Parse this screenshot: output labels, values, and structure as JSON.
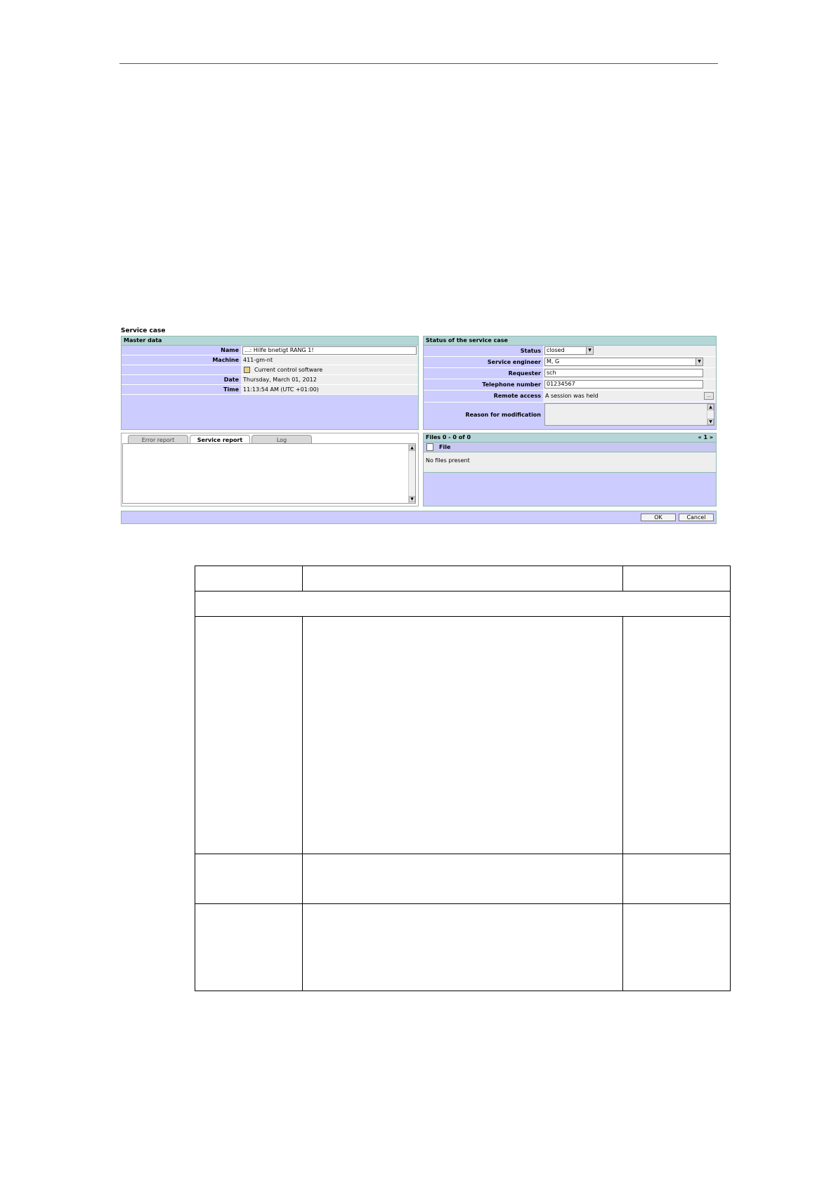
{
  "service_case": {
    "title": "Service case",
    "master_data": {
      "header": "Master data",
      "fields": [
        {
          "label": "Name",
          "value": "...: Hilfe bnetigt RANG 1!"
        },
        {
          "label": "Machine",
          "value": "411-gm-nt"
        },
        {
          "label": "",
          "value": "Current control software"
        },
        {
          "label": "Date",
          "value": "Thursday, March 01, 2012"
        },
        {
          "label": "Time",
          "value": "11:13:54 AM (UTC +01:00)"
        }
      ]
    },
    "status_panel": {
      "header": "Status of the service case",
      "fields": [
        {
          "label": "Status",
          "value": "closed"
        },
        {
          "label": "Service engineer",
          "value": "M, G"
        },
        {
          "label": "Requester",
          "value": "sch"
        },
        {
          "label": "Telephone number",
          "value": "01234567"
        },
        {
          "label": "Remote access",
          "value": "A session was held"
        },
        {
          "label": "Reason for modification",
          "value": ""
        }
      ]
    },
    "tabs": [
      {
        "label": "Error report",
        "active": false
      },
      {
        "label": "Service report",
        "active": true
      },
      {
        "label": "Log",
        "active": false
      }
    ],
    "files": {
      "header": "Files 0 - 0 of 0",
      "pager": "« 1 »",
      "column": "File",
      "empty": "No files present"
    },
    "buttons": {
      "ok": "OK",
      "cancel": "Cancel"
    }
  }
}
